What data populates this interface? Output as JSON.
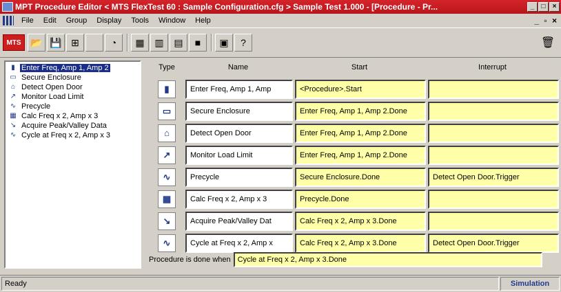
{
  "window": {
    "title": "MPT Procedure Editor  < MTS FlexTest 60 : Sample Configuration.cfg >  Sample Test 1.000 - [Procedure - Pr...",
    "controls": [
      "_",
      "□",
      "×"
    ]
  },
  "menu": {
    "items": [
      "File",
      "Edit",
      "Group",
      "Display",
      "Tools",
      "Window",
      "Help"
    ],
    "mdi_controls": "_ ▫ ×"
  },
  "toolbar": {
    "logo": "MTS",
    "buttons": [
      {
        "icon": "open-icon",
        "glyph": "📂"
      },
      {
        "icon": "save-icon",
        "glyph": "💾"
      },
      {
        "icon": "network-icon",
        "glyph": "⊞"
      },
      {
        "icon": "blank-icon",
        "glyph": ""
      },
      {
        "icon": "clock-icon",
        "glyph": "◔"
      },
      {
        "icon": "grid-icon",
        "glyph": "▦"
      },
      {
        "icon": "chart-icon",
        "glyph": "▥"
      },
      {
        "icon": "bars-icon",
        "glyph": "▤"
      },
      {
        "icon": "monitor-icon",
        "glyph": "■"
      },
      {
        "icon": "document-icon",
        "glyph": "▣"
      },
      {
        "icon": "help-icon",
        "glyph": "?"
      }
    ],
    "trash_glyph": "🗑"
  },
  "tree": {
    "items": [
      {
        "label": "Enter Freq, Amp 1, Amp 2",
        "icon": "input-icon",
        "glyph": "▮",
        "selected": true
      },
      {
        "label": "Secure Enclosure",
        "icon": "enclosure-icon",
        "glyph": "▭"
      },
      {
        "label": "Detect Open Door",
        "icon": "door-icon",
        "glyph": "⌂"
      },
      {
        "label": "Monitor Load Limit",
        "icon": "monitor-load-icon",
        "glyph": "↗"
      },
      {
        "label": "Precycle",
        "icon": "wave-icon",
        "glyph": "∿"
      },
      {
        "label": "Calc Freq x 2, Amp  x 3",
        "icon": "calculator-icon",
        "glyph": "▦"
      },
      {
        "label": "Acquire Peak/Valley Data",
        "icon": "acquire-icon",
        "glyph": "↘"
      },
      {
        "label": "Cycle at Freq x 2, Amp x 3",
        "icon": "wave-icon",
        "glyph": "∿"
      }
    ]
  },
  "grid": {
    "headers": {
      "type": "Type",
      "name": "Name",
      "start": "Start",
      "interrupt": "Interrupt"
    },
    "rows": [
      {
        "icon": "input-icon",
        "glyph": "▮",
        "name": "Enter Freq, Amp 1, Amp",
        "start": "<Procedure>.Start",
        "interrupt": ""
      },
      {
        "icon": "enclosure-icon",
        "glyph": "▭",
        "name": "Secure Enclosure",
        "start": "Enter Freq, Amp 1, Amp 2.Done",
        "interrupt": ""
      },
      {
        "icon": "door-icon",
        "glyph": "⌂",
        "name": "Detect Open Door",
        "start": "Enter Freq, Amp 1, Amp 2.Done",
        "interrupt": ""
      },
      {
        "icon": "monitor-load-icon",
        "glyph": "↗",
        "name": "Monitor Load Limit",
        "start": "Enter Freq, Amp 1, Amp 2.Done",
        "interrupt": ""
      },
      {
        "icon": "wave-icon",
        "glyph": "∿",
        "name": "Precycle",
        "start": "Secure Enclosure.Done",
        "interrupt": "Detect Open Door.Trigger"
      },
      {
        "icon": "calculator-icon",
        "glyph": "▦",
        "name": "Calc Freq x 2, Amp  x 3",
        "start": "Precycle.Done",
        "interrupt": ""
      },
      {
        "icon": "acquire-icon",
        "glyph": "↘",
        "name": "Acquire Peak/Valley Dat",
        "start": "Calc Freq x 2, Amp  x 3.Done",
        "interrupt": ""
      },
      {
        "icon": "wave-icon",
        "glyph": "∿",
        "name": "Cycle at Freq x 2, Amp x",
        "start": "Calc Freq x 2, Amp  x 3.Done",
        "interrupt": "Detect Open Door.Trigger"
      }
    ]
  },
  "done": {
    "label": "Procedure is done when",
    "value": "Cycle at Freq x 2, Amp x 3.Done"
  },
  "status": {
    "left": "Ready",
    "right": "Simulation"
  },
  "colors": {
    "title_bar": "#c81e24",
    "selection": "#1a2d8a",
    "field_yellow": "#ffffa8"
  }
}
